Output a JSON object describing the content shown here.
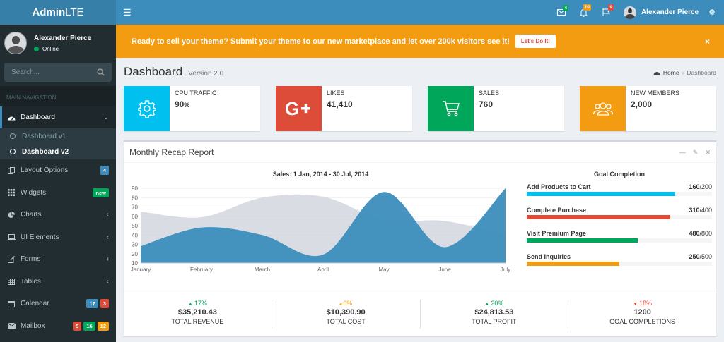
{
  "colors": {
    "primary": "#3c8dbc",
    "aqua": "#00c0ef",
    "red": "#dd4b39",
    "green": "#00a65a",
    "yellow": "#f39c12",
    "sidebar": "#222d32"
  },
  "logo": {
    "bold": "Admin",
    "light": "LTE"
  },
  "user": {
    "name": "Alexander Pierce",
    "status": "Online"
  },
  "search": {
    "placeholder": "Search..."
  },
  "sidebar": {
    "header": "MAIN NAVIGATION",
    "dashboard": "Dashboard",
    "sub": [
      "Dashboard v1",
      "Dashboard v2"
    ],
    "items": [
      {
        "label": "Layout Options",
        "icon": "files-icon",
        "badges": [
          {
            "text": "4",
            "color": "#3c8dbc"
          }
        ]
      },
      {
        "label": "Widgets",
        "icon": "th-icon",
        "badges": [
          {
            "text": "new",
            "color": "#00a65a"
          }
        ]
      },
      {
        "label": "Charts",
        "icon": "pie-chart-icon",
        "arrow": "‹"
      },
      {
        "label": "UI Elements",
        "icon": "laptop-icon",
        "arrow": "‹"
      },
      {
        "label": "Forms",
        "icon": "edit-icon",
        "arrow": "‹"
      },
      {
        "label": "Tables",
        "icon": "table-icon",
        "arrow": "‹"
      },
      {
        "label": "Calendar",
        "icon": "calendar-icon",
        "badges": [
          {
            "text": "17",
            "color": "#3c8dbc"
          },
          {
            "text": "3",
            "color": "#dd4b39"
          }
        ]
      },
      {
        "label": "Mailbox",
        "icon": "envelope-icon",
        "badges": [
          {
            "text": "5",
            "color": "#dd4b39"
          },
          {
            "text": "16",
            "color": "#00a65a"
          },
          {
            "text": "12",
            "color": "#f39c12"
          }
        ]
      }
    ]
  },
  "topbar": {
    "messages": "4",
    "notifications": "10",
    "tasks": "9",
    "user": "Alexander Pierce"
  },
  "banner": {
    "text": "Ready to sell your theme? Submit your theme to our new marketplace and let over 200k visitors see it!",
    "button": "Let's Do It!",
    "close": "×"
  },
  "header": {
    "title": "Dashboard",
    "subtitle": "Version 2.0",
    "home": "Home",
    "current": "Dashboard"
  },
  "infoboxes": [
    {
      "label": "CPU TRAFFIC",
      "value": "90",
      "unit": "%",
      "color": "#00c0ef",
      "icon": "gear-icon"
    },
    {
      "label": "LIKES",
      "value": "41,410",
      "unit": "",
      "color": "#dd4b39",
      "icon": "google-plus-icon"
    },
    {
      "label": "SALES",
      "value": "760",
      "unit": "",
      "color": "#00a65a",
      "icon": "shopping-cart-icon"
    },
    {
      "label": "NEW MEMBERS",
      "value": "2,000",
      "unit": "",
      "color": "#f39c12",
      "icon": "users-icon"
    }
  ],
  "report": {
    "title": "Monthly Recap Report",
    "chart_title": "Sales: 1 Jan, 2014 - 30 Jul, 2014",
    "goal_title": "Goal Completion"
  },
  "goals": [
    {
      "label": "Add Products to Cart",
      "value": "160",
      "total": "/200",
      "fraction": 0.8,
      "color": "#00c0ef"
    },
    {
      "label": "Complete Purchase",
      "value": "310",
      "total": "/400",
      "fraction": 0.775,
      "color": "#dd4b39"
    },
    {
      "label": "Visit Premium Page",
      "value": "480",
      "total": "/800",
      "fraction": 0.6,
      "color": "#00a65a"
    },
    {
      "label": "Send Inquiries",
      "value": "250",
      "total": "/500",
      "fraction": 0.5,
      "color": "#f39c12"
    }
  ],
  "footer_stats": [
    {
      "pct": "17%",
      "dir": "up",
      "color": "#00a65a",
      "amount": "$35,210.43",
      "label": "TOTAL REVENUE"
    },
    {
      "pct": "0%",
      "dir": "flat",
      "color": "#f39c12",
      "amount": "$10,390.90",
      "label": "TOTAL COST"
    },
    {
      "pct": "20%",
      "dir": "up",
      "color": "#00a65a",
      "amount": "$24,813.53",
      "label": "TOTAL PROFIT"
    },
    {
      "pct": "18%",
      "dir": "down",
      "color": "#dd4b39",
      "amount": "1200",
      "label": "GOAL COMPLETIONS"
    }
  ],
  "chart_data": {
    "type": "area",
    "categories": [
      "January",
      "February",
      "March",
      "April",
      "May",
      "June",
      "July"
    ],
    "series": [
      {
        "values": [
          65,
          59,
          80,
          81,
          56,
          55,
          40
        ],
        "color": "#d2d6de"
      },
      {
        "values": [
          28,
          48,
          40,
          19,
          86,
          27,
          90
        ],
        "color": "#3c8dbc"
      }
    ],
    "yticks": [
      10,
      20,
      30,
      40,
      50,
      60,
      70,
      80,
      90
    ],
    "ylim": [
      10,
      90
    ]
  }
}
